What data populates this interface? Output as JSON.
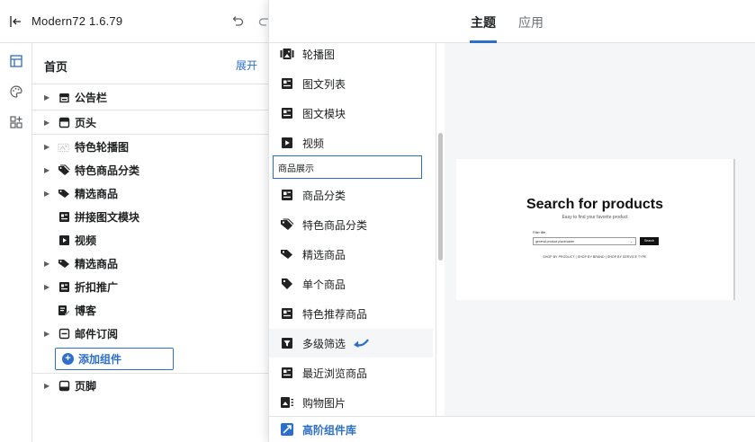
{
  "app": {
    "title": "Modern72 1.6.79"
  },
  "sidebar": {
    "title": "首页",
    "expand_label": "展开",
    "items": [
      {
        "label": "公告栏",
        "icon": "store-icon",
        "chevron": true
      },
      {
        "label": "页头",
        "icon": "header-icon",
        "chevron": true
      },
      {
        "label": "特色轮播图",
        "icon": "image-icon",
        "chevron": true
      },
      {
        "label": "特色商品分类",
        "icon": "tag-icon",
        "chevron": true
      },
      {
        "label": "精选商品",
        "icon": "tags-icon",
        "chevron": true
      },
      {
        "label": "拼接图文模块",
        "icon": "image-text-icon",
        "chevron": false
      },
      {
        "label": "视频",
        "icon": "video-icon",
        "chevron": false
      },
      {
        "label": "精选商品",
        "icon": "tags-icon",
        "chevron": true
      },
      {
        "label": "折扣推广",
        "icon": "image-text-icon",
        "chevron": true
      },
      {
        "label": "博客",
        "icon": "blog-icon",
        "chevron": false
      },
      {
        "label": "邮件订阅",
        "icon": "mail-icon",
        "chevron": true
      }
    ],
    "add_component_label": "添加组件",
    "footer_item": {
      "label": "页脚",
      "icon": "footer-icon"
    }
  },
  "popover": {
    "tabs": [
      "主题",
      "应用"
    ],
    "list_items": [
      {
        "label": "轮播图",
        "icon": "carousel-icon"
      },
      {
        "label": "图文列表",
        "icon": "image-text-icon"
      },
      {
        "label": "图文模块",
        "icon": "image-text-icon"
      },
      {
        "label": "视频",
        "icon": "video-icon"
      }
    ],
    "section_label": "商品展示",
    "product_items": [
      {
        "label": "商品分类",
        "icon": "image-text-icon"
      },
      {
        "label": "特色商品分类",
        "icon": "tag-icon"
      },
      {
        "label": "精选商品",
        "icon": "tags-icon"
      },
      {
        "label": "单个商品",
        "icon": "single-tag-icon"
      },
      {
        "label": "特色推荐商品",
        "icon": "image-text-icon"
      },
      {
        "label": "多级筛选",
        "icon": "filter-icon"
      },
      {
        "label": "最近浏览商品",
        "icon": "image-text-icon"
      },
      {
        "label": "购物图片",
        "icon": "shopping-image-icon"
      }
    ],
    "footer_label": "高阶组件库",
    "preview": {
      "title": "Search for products",
      "subtitle": "Easy to find your favorite product",
      "filter_label": "Filter title",
      "select_value": "general product placeholder",
      "search_label": "Search",
      "links": "SHOP BY PRODUCT  |  SHOP BY BRAND  |  SHOP BY SERVICE TYPE"
    }
  },
  "colors": {
    "accent": "#2c6ecb",
    "text": "#202223",
    "muted": "#6d7175",
    "border": "#e3e3e3"
  }
}
